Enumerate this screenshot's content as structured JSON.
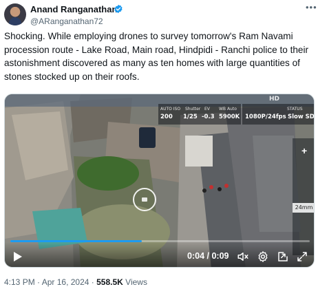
{
  "author": {
    "name": "Anand Ranganathan",
    "handle": "@ARanganathan72",
    "verified": true
  },
  "tweet": {
    "text": "Shocking. While employing drones to survey tomorrow's Ram Navami procession route - Lake Road, Main road, Hindpidi - Ranchi police to their astonishment discovered as many as ten homes with large quantities of stones stocked up on their roofs."
  },
  "video": {
    "current_time": "0:04",
    "duration": "0:09",
    "progress": 0.44,
    "overlay": {
      "auto_iso": "AUTO ISO",
      "shutter_label": "Shutter",
      "ev_label": "EV",
      "wb_label": "WB Auto",
      "iso": "200",
      "shutter": "1/25",
      "ev": "-0.3",
      "wb": "5900K",
      "status_label": "STATUS",
      "resolution": "1080P/24fps",
      "mode": "Slow SD",
      "top_right": "HD",
      "zoom": "24mm",
      "plus": "+"
    }
  },
  "meta": {
    "time": "4:13 PM",
    "separator1": "·",
    "date": "Apr 16, 2024",
    "separator2": "·",
    "views_count": "558.5K",
    "views_label": "Views"
  },
  "colors": {
    "accent": "#1d9bf0",
    "text_secondary": "#536471"
  },
  "icons": [
    "more-icon",
    "verified-icon",
    "play-icon",
    "volume-muted-icon",
    "settings-icon",
    "pip-icon",
    "fullscreen-icon"
  ]
}
